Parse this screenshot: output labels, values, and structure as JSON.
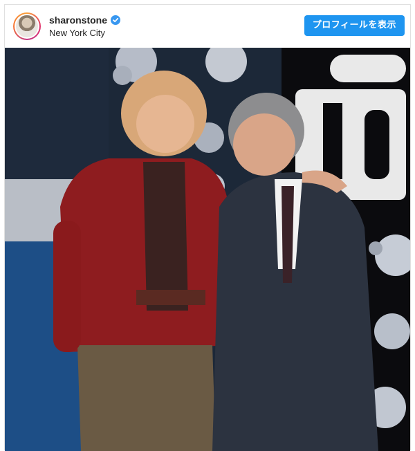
{
  "post": {
    "username": "sharonstone",
    "verified": true,
    "location": "New York City",
    "profile_button_label": "プロフィールを表示"
  },
  "icons": {
    "verified": "verified-badge-icon",
    "avatar": "profile-avatar"
  },
  "colors": {
    "accent": "#1e95f0",
    "verified": "#3897f0",
    "text": "#262626"
  }
}
